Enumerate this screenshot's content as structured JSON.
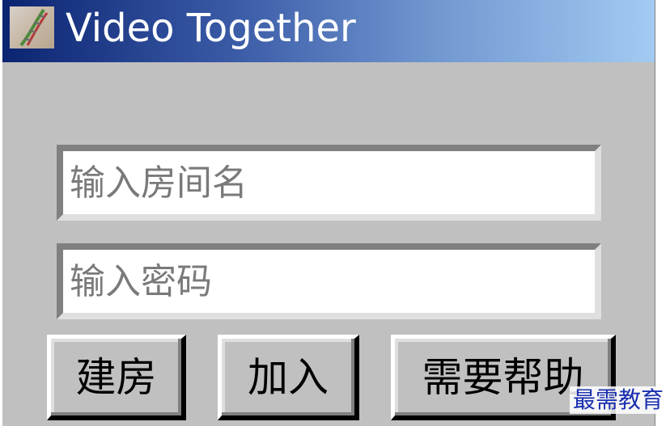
{
  "window": {
    "title": "Video Together",
    "icon": "dna-icon"
  },
  "form": {
    "room_name": {
      "value": "",
      "placeholder": "输入房间名"
    },
    "password": {
      "value": "",
      "placeholder": "输入密码"
    }
  },
  "buttons": {
    "create_label": "建房",
    "join_label": "加入",
    "help_label": "需要帮助"
  },
  "watermark": {
    "text": "最需教育"
  },
  "colors": {
    "window_bg": "#c0c0c0",
    "titlebar_start": "#0b2472",
    "titlebar_end": "#a2cbf2",
    "watermark": "#1a2fb0"
  }
}
